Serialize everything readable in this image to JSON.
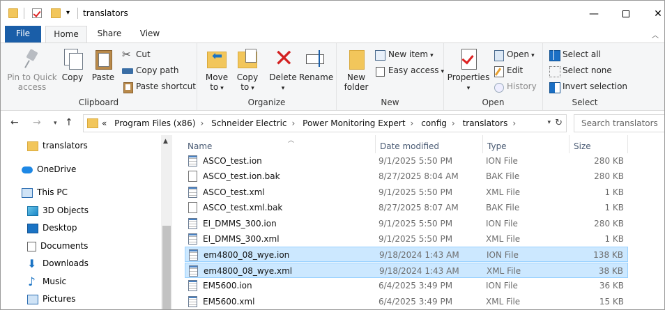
{
  "window": {
    "title": "translators"
  },
  "tabs": [
    "File",
    "Home",
    "Share",
    "View"
  ],
  "ribbon": {
    "clipboard": {
      "label": "Clipboard",
      "pin_line1": "Pin to Quick",
      "pin_line2": "access",
      "copy": "Copy",
      "paste": "Paste",
      "cut": "Cut",
      "copy_path": "Copy path",
      "paste_shortcut": "Paste shortcut"
    },
    "organize": {
      "label": "Organize",
      "move_line1": "Move",
      "move_line2": "to",
      "copy_line1": "Copy",
      "copy_line2": "to",
      "delete": "Delete",
      "rename": "Rename"
    },
    "new": {
      "label": "New",
      "new_folder_line1": "New",
      "new_folder_line2": "folder",
      "new_item": "New item",
      "easy_access": "Easy access"
    },
    "open": {
      "label": "Open",
      "properties": "Properties",
      "open": "Open",
      "edit": "Edit",
      "history": "History"
    },
    "select": {
      "label": "Select",
      "select_all": "Select all",
      "select_none": "Select none",
      "invert_selection": "Invert selection"
    }
  },
  "address": {
    "prefix": "«",
    "crumbs": [
      "Program Files (x86)",
      "Schneider Electric",
      "Power Monitoring Expert",
      "config",
      "translators"
    ],
    "search_placeholder": "Search translators"
  },
  "nav": {
    "items": [
      "translators",
      "OneDrive",
      "This PC",
      "3D Objects",
      "Desktop",
      "Documents",
      "Downloads",
      "Music",
      "Pictures"
    ]
  },
  "columns": {
    "name": "Name",
    "date": "Date modified",
    "type": "Type",
    "size": "Size"
  },
  "files": [
    {
      "name": "ASCO_test.ion",
      "date": "9/1/2025 5:50 PM",
      "type": "ION File",
      "size": "280 KB",
      "icon": "text-file-icon",
      "selected": false
    },
    {
      "name": "ASCO_test.ion.bak",
      "date": "8/27/2025 8:04 AM",
      "type": "BAK File",
      "size": "280 KB",
      "icon": "generic-file-icon",
      "selected": false
    },
    {
      "name": "ASCO_test.xml",
      "date": "9/1/2025 5:50 PM",
      "type": "XML File",
      "size": "1 KB",
      "icon": "text-file-icon",
      "selected": false
    },
    {
      "name": "ASCO_test.xml.bak",
      "date": "8/27/2025 8:07 AM",
      "type": "BAK File",
      "size": "1 KB",
      "icon": "generic-file-icon",
      "selected": false
    },
    {
      "name": "EI_DMMS_300.ion",
      "date": "9/1/2025 5:50 PM",
      "type": "ION File",
      "size": "280 KB",
      "icon": "text-file-icon",
      "selected": false
    },
    {
      "name": "EI_DMMS_300.xml",
      "date": "9/1/2025 5:50 PM",
      "type": "XML File",
      "size": "1 KB",
      "icon": "text-file-icon",
      "selected": false
    },
    {
      "name": "em4800_08_wye.ion",
      "date": "9/18/2024 1:43 AM",
      "type": "ION File",
      "size": "138 KB",
      "icon": "text-file-icon",
      "selected": true
    },
    {
      "name": "em4800_08_wye.xml",
      "date": "9/18/2024 1:43 AM",
      "type": "XML File",
      "size": "38 KB",
      "icon": "text-file-icon",
      "selected": true
    },
    {
      "name": "EM5600.ion",
      "date": "6/4/2025 3:49 PM",
      "type": "ION File",
      "size": "36 KB",
      "icon": "text-file-icon",
      "selected": false
    },
    {
      "name": "EM5600.xml",
      "date": "6/4/2025 3:49 PM",
      "type": "XML File",
      "size": "15 KB",
      "icon": "text-file-icon",
      "selected": false
    }
  ],
  "colors": {
    "file_tab": "#1a5ea8",
    "selection_bg": "#cce8ff",
    "selection_border": "#99d1ff",
    "folder": "#f2c65b",
    "delete_red": "#d32020"
  }
}
